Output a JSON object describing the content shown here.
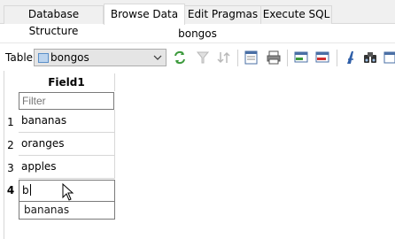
{
  "tabs": [
    {
      "label": "Database Structure",
      "active": false
    },
    {
      "label": "Browse Data",
      "active": true
    },
    {
      "label": "Edit Pragmas",
      "active": false
    },
    {
      "label": "Execute SQL",
      "active": false
    }
  ],
  "table_title": "bongos",
  "toolbar": {
    "table_label": "Table:",
    "table_select_value": "bongos",
    "icons": [
      "refresh-icon",
      "clear-filters-icon",
      "sort-icon",
      "save-filter-icon",
      "print-icon",
      "insert-record-icon",
      "delete-record-icon",
      "font-icon",
      "find-icon"
    ]
  },
  "grid": {
    "column_header": "Field1",
    "filter_placeholder": "Filter",
    "rows": [
      {
        "number": "1",
        "value": "bananas"
      },
      {
        "number": "2",
        "value": "oranges"
      },
      {
        "number": "3",
        "value": "apples"
      }
    ],
    "edit_row": {
      "number": "4",
      "value": "b"
    },
    "autocomplete_suggestion": "bananas"
  },
  "colors": {
    "tab_bar_background": "#f0f0f0",
    "active_tab_background": "#ffffff",
    "border": "#d7d7d7"
  }
}
